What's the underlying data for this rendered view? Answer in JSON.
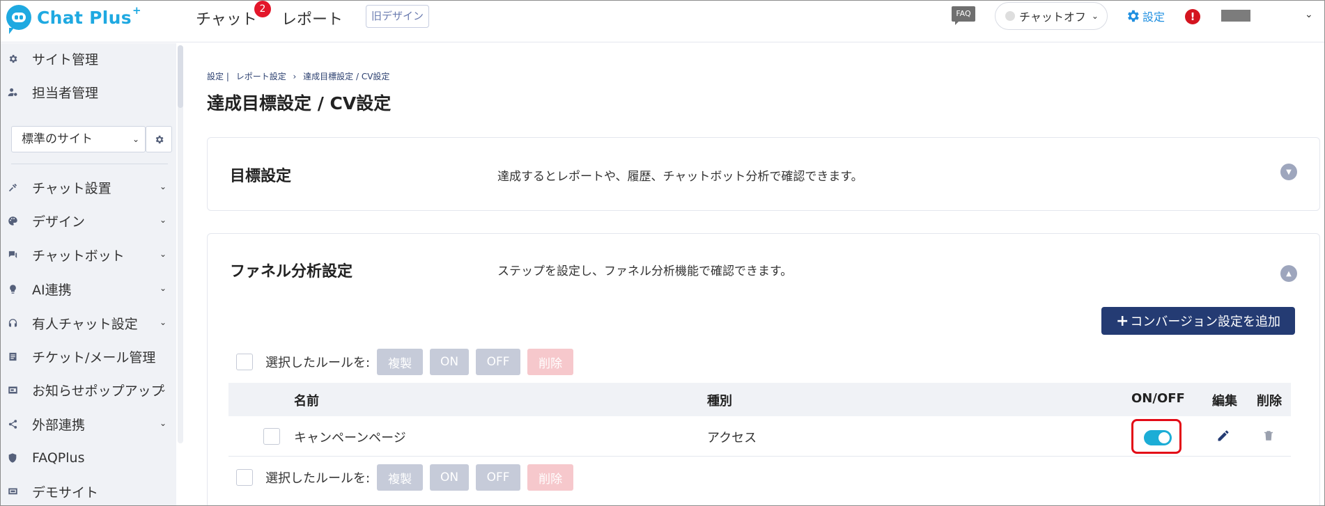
{
  "header": {
    "logo_text": "Chat Plus",
    "logo_plus": "+",
    "nav_chat": "チャット",
    "nav_chat_badge": "2",
    "nav_report": "レポート",
    "old_design": "旧デザイン",
    "faq_label": "FAQ",
    "chat_status": "チャットオフ",
    "settings_label": "設定",
    "alert_symbol": "!"
  },
  "sidebar": {
    "items_top": [
      {
        "label": "サイト管理",
        "icon": "gear-icon"
      },
      {
        "label": "担当者管理",
        "icon": "user-settings-icon"
      }
    ],
    "site_select": "標準のサイト",
    "items": [
      {
        "label": "チャット設置",
        "icon": "tools-icon",
        "expandable": true
      },
      {
        "label": "デザイン",
        "icon": "palette-icon",
        "expandable": true
      },
      {
        "label": "チャットボット",
        "icon": "bot-chat-icon",
        "expandable": true
      },
      {
        "label": "AI連携",
        "icon": "bulb-icon",
        "expandable": true
      },
      {
        "label": "有人チャット設定",
        "icon": "headset-icon",
        "expandable": true
      },
      {
        "label": "チケット/メール管理",
        "icon": "ticket-icon",
        "expandable": false
      },
      {
        "label": "お知らせポップアップ",
        "icon": "popup-icon",
        "expandable": true
      },
      {
        "label": "外部連携",
        "icon": "share-icon",
        "expandable": true
      },
      {
        "label": "FAQPlus",
        "icon": "faq-shield-icon",
        "expandable": false
      },
      {
        "label": "デモサイト",
        "icon": "demo-site-icon",
        "expandable": false
      }
    ]
  },
  "breadcrumb": [
    "設定 |",
    "レポート設定",
    "›",
    "達成目標設定 / CV設定"
  ],
  "page_title": "達成目標設定 / CV設定",
  "goal_card": {
    "title": "目標設定",
    "description": "達成するとレポートや、履歴、チャットボット分析で確認できます。"
  },
  "funnel_card": {
    "title": "ファネル分析設定",
    "description": "ステップを設定し、ファネル分析機能で確認できます。",
    "add_button": "コンバージョン設定を追加",
    "add_button_plus": "+"
  },
  "bulk": {
    "label": "選択したルールを:",
    "copy": "複製",
    "on": "ON",
    "off": "OFF",
    "delete": "削除"
  },
  "table": {
    "headers": {
      "name": "名前",
      "type": "種別",
      "onoff": "ON/OFF",
      "edit": "編集",
      "delete": "削除"
    },
    "rows": [
      {
        "name": "キャンペーンページ",
        "type": "アクセス",
        "enabled": true
      }
    ]
  },
  "colors": {
    "brand": "#1fa9e1",
    "primary_button": "#243b73",
    "switch_on": "#1cadd6",
    "highlight_outline": "#e30b17",
    "badge": "#e3162a"
  }
}
